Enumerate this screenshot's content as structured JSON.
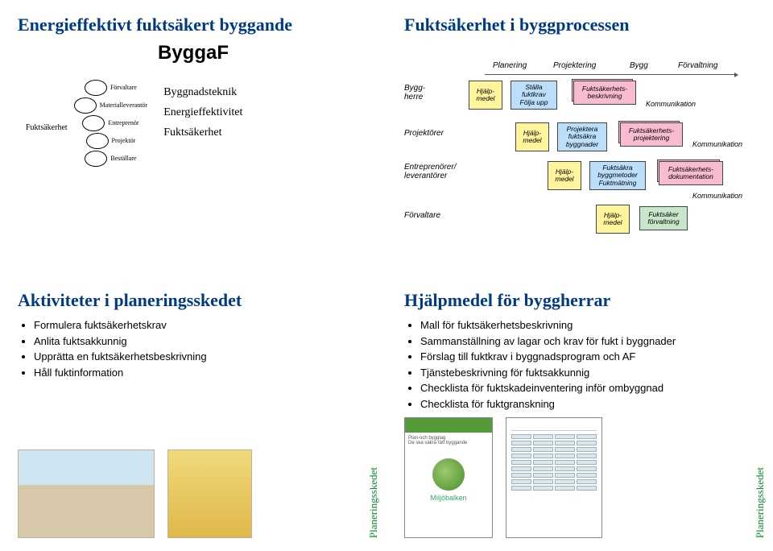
{
  "slide1": {
    "title": "Energieffektivt fuktsäkert byggande",
    "subtitle": "ByggaF",
    "chain_left_label": "Fuktsäkerhet",
    "chain_items": [
      "Förvaltare",
      "Materialleverantör",
      "Entreprenör",
      "Projektör",
      "Beställare"
    ],
    "right_items": [
      "Byggnadsteknik",
      "Energieffektivitet",
      "Fuktsäkerhet"
    ]
  },
  "slide2": {
    "title": "Fuktsäkerhet i byggprocessen",
    "cols": [
      "Planering",
      "Projektering",
      "Bygg",
      "Förvaltning"
    ],
    "rows": [
      "Bygg-\nherre",
      "Projektörer",
      "Entreprenörer/\nleverantörer",
      "Förvaltare"
    ],
    "hj": "Hjälp-\nmedel",
    "r1_blue": "Ställa\nfuktkrav\nFölja upp",
    "r1_pink": "Fuktsäkerhets-\nbeskrivning",
    "r2_blue": "Projektera\nfuktsäkra\nbyggnader",
    "r2_pink": "Fuktsäkerhets-\nprojektering",
    "r3_blue": "Fuktsäkra\nbyggmetoder\nFuktmätning",
    "r3_pink": "Fuktsäkerhets-\ndokumentation",
    "r4_blue": "Fuktsäker\nförvaltning",
    "komm": "Kommunikation"
  },
  "slide3": {
    "title": "Aktiviteter i planeringsskedet",
    "bullets": [
      "Formulera fuktsäkerhetskrav",
      "Anlita fuktsakkunnig",
      "Upprätta en fuktsäkerhetsbeskrivning",
      "Håll fuktinformation"
    ],
    "side": "Planeringsskedet"
  },
  "slide4": {
    "title": "Hjälpmedel för byggherrar",
    "bullets": [
      "Mall för fuktsäkerhetsbeskrivning",
      "Sammanställning av lagar och krav för fukt i byggnader",
      "Förslag till fuktkrav i byggnadsprogram och AF",
      "Tjänstebeskrivning för fuktsakkunnig",
      "Checklista för fuktskadeinventering inför ombyggnad",
      "Checklista för fuktgranskning"
    ],
    "doc1_caption": "Miljöbalken",
    "side": "Planeringsskedet"
  }
}
